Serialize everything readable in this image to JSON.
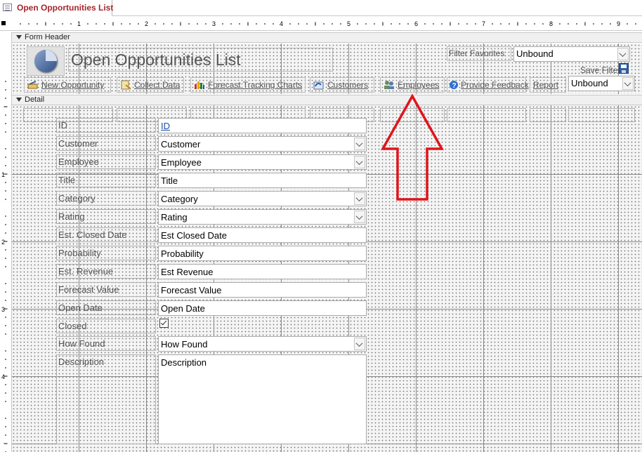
{
  "document_tab": {
    "title": "Open Opportunities List",
    "icon": "form-icon"
  },
  "ruler": {
    "marks": [
      "1",
      "2",
      "3",
      "4",
      "5",
      "6",
      "7",
      "8",
      "9"
    ],
    "vmarks": [
      "1",
      "2",
      "3",
      "4"
    ]
  },
  "sections": {
    "form_header": "Form Header",
    "detail": "Detail"
  },
  "header": {
    "title": "Open Opportunities List",
    "filter_favorites_label": "Filter Favorites",
    "filter_favorites_value": "Unbound",
    "save_filter_label": "Save Filter",
    "report_label": "Report",
    "report_value": "Unbound",
    "buttons": [
      {
        "label": "New Opportunity",
        "icon": "new-record-icon"
      },
      {
        "label": "Collect Data",
        "icon": "collect-data-icon"
      },
      {
        "label": "Forecast Tracking Charts",
        "icon": "chart-icon"
      },
      {
        "label": "Customers",
        "icon": "customers-icon"
      },
      {
        "label": "Employees",
        "icon": "employees-icon"
      },
      {
        "label": "Provide Feedback",
        "icon": "help-icon"
      }
    ]
  },
  "fields": [
    {
      "label": "ID",
      "value": "ID",
      "type": "link"
    },
    {
      "label": "Customer",
      "value": "Customer",
      "type": "combo"
    },
    {
      "label": "Employee",
      "value": "Employee",
      "type": "combo"
    },
    {
      "label": "Title",
      "value": "Title",
      "type": "text"
    },
    {
      "label": "Category",
      "value": "Category",
      "type": "combo"
    },
    {
      "label": "Rating",
      "value": "Rating",
      "type": "combo"
    },
    {
      "label": "Est. Closed Date",
      "value": "Est Closed Date",
      "type": "text"
    },
    {
      "label": "Probability",
      "value": "Probability",
      "type": "text"
    },
    {
      "label": "Est. Revenue",
      "value": "Est Revenue",
      "type": "text"
    },
    {
      "label": "Forecast Value",
      "value": "Forecast Value",
      "type": "text"
    },
    {
      "label": "Open Date",
      "value": "Open Date",
      "type": "text"
    },
    {
      "label": "Closed",
      "value": "",
      "type": "checkbox"
    },
    {
      "label": "How Found",
      "value": "How Found",
      "type": "combo"
    },
    {
      "label": "Description",
      "value": "Description",
      "type": "memo"
    }
  ],
  "annotation": {
    "shape": "red-up-arrow",
    "color": "#e0141b"
  },
  "colors": {
    "tab_title": "#a4262c",
    "link": "#1f4ea3",
    "arrow": "#e0141b"
  }
}
